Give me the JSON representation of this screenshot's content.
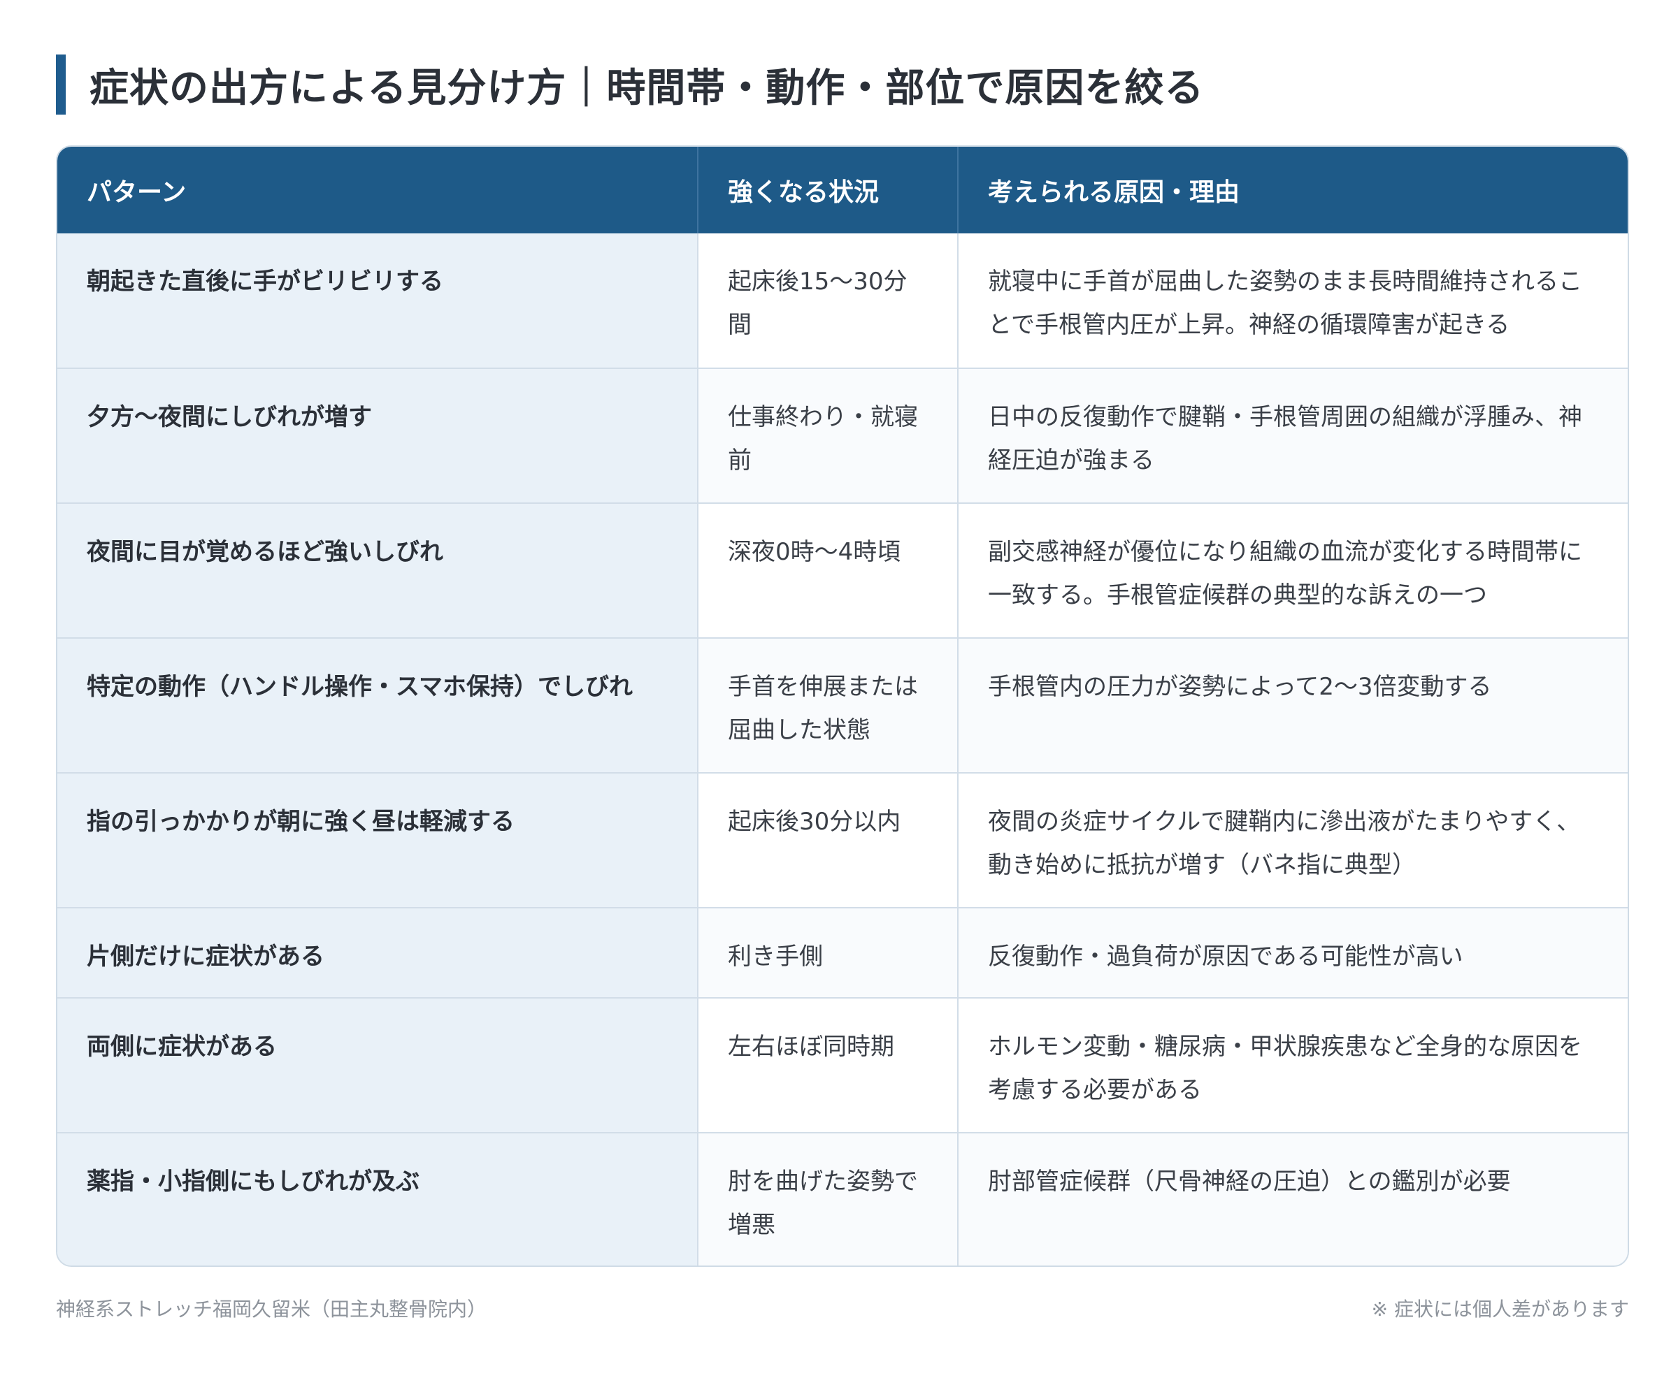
{
  "title": "症状の出方による見分け方｜時間帯・動作・部位で原因を絞る",
  "table": {
    "headers": [
      "パターン",
      "強くなる状況",
      "考えられる原因・理由"
    ],
    "rows": [
      [
        "朝起きた直後に手がビリビリする",
        "起床後15〜30分間",
        "就寝中に手首が屈曲した姿勢のまま長時間維持されることで手根管内圧が上昇。神経の循環障害が起きる"
      ],
      [
        "夕方〜夜間にしびれが増す",
        "仕事終わり・就寝前",
        "日中の反復動作で腱鞘・手根管周囲の組織が浮腫み、神経圧迫が強まる"
      ],
      [
        "夜間に目が覚めるほど強いしびれ",
        "深夜0時〜4時頃",
        "副交感神経が優位になり組織の血流が変化する時間帯に一致する。手根管症候群の典型的な訴えの一つ"
      ],
      [
        "特定の動作（ハンドル操作・スマホ保持）でしびれ",
        "手首を伸展または屈曲した状態",
        "手根管内の圧力が姿勢によって2〜3倍変動する"
      ],
      [
        "指の引っかかりが朝に強く昼は軽減する",
        "起床後30分以内",
        "夜間の炎症サイクルで腱鞘内に滲出液がたまりやすく、動き始めに抵抗が増す（バネ指に典型）"
      ],
      [
        "片側だけに症状がある",
        "利き手側",
        "反復動作・過負荷が原因である可能性が高い"
      ],
      [
        "両側に症状がある",
        "左右ほぼ同時期",
        "ホルモン変動・糖尿病・甲状腺疾患など全身的な原因を考慮する必要がある"
      ],
      [
        "薬指・小指側にもしびれが及ぶ",
        "肘を曲げた姿勢で増悪",
        "肘部管症候群（尺骨神経の圧迫）との鑑別が必要"
      ]
    ]
  },
  "footer": {
    "source": "神経系ストレッチ福岡久留米（田主丸整骨院内）",
    "note": "※ 症状には個人差があります"
  }
}
